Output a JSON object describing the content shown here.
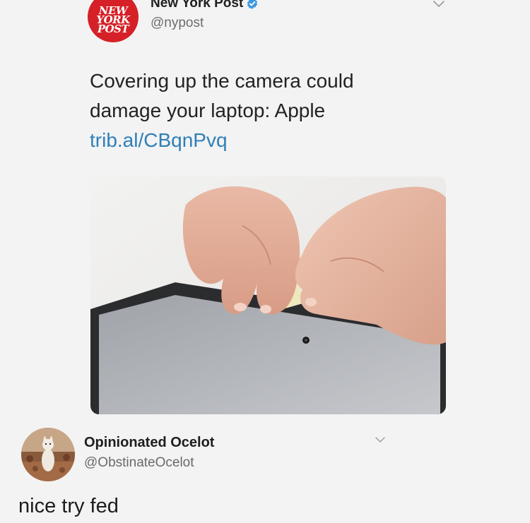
{
  "tweet": {
    "avatar_logo_lines": [
      "NEW",
      "YORK",
      "POST"
    ],
    "author_name": "New York Post",
    "verified_icon": "verified-badge-icon",
    "handle": "@nypost",
    "text": "Covering up the camera could damage your laptop: Apple ",
    "link_text": "trib.al/CBqnPvq",
    "colors": {
      "brand_red": "#d62027",
      "link_blue": "#2f7fb9",
      "verified_blue": "#3d97e0"
    }
  },
  "reply": {
    "author_name": "Opinionated Ocelot",
    "handle": "@ObstinateOcelot",
    "text": "nice try fed"
  }
}
